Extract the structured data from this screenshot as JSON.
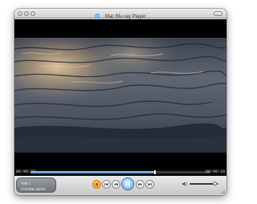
{
  "window": {
    "title": "Mac Blu-ray Player",
    "title_icon": "blu-ray-disc-icon"
  },
  "video": {
    "description_icon": "video-frame",
    "scene_colors": {
      "sky_glare": "#d6b48a",
      "water_dark": "#2b3340",
      "water_mid": "#6f7682"
    }
  },
  "playback": {
    "elapsed": "00:00:22",
    "remaining": "00:00:10",
    "progress_fraction": 0.69
  },
  "info_panel": {
    "line1": "Title 1",
    "line2": "DVD/BD ab001"
  },
  "controls": {
    "buttons": [
      {
        "name": "menu-button",
        "icon": "menu-icon"
      },
      {
        "name": "previous-chapter-button",
        "icon": "previous-chapter-icon"
      },
      {
        "name": "rewind-button",
        "icon": "rewind-icon"
      },
      {
        "name": "play-pause-button",
        "icon": "pause-icon"
      },
      {
        "name": "fast-forward-button",
        "icon": "fast-forward-icon"
      },
      {
        "name": "next-chapter-button",
        "icon": "next-chapter-icon"
      }
    ],
    "volume_fraction": 0.85,
    "accent": "#3f83c9",
    "menu_button_color": "#f29a12"
  }
}
